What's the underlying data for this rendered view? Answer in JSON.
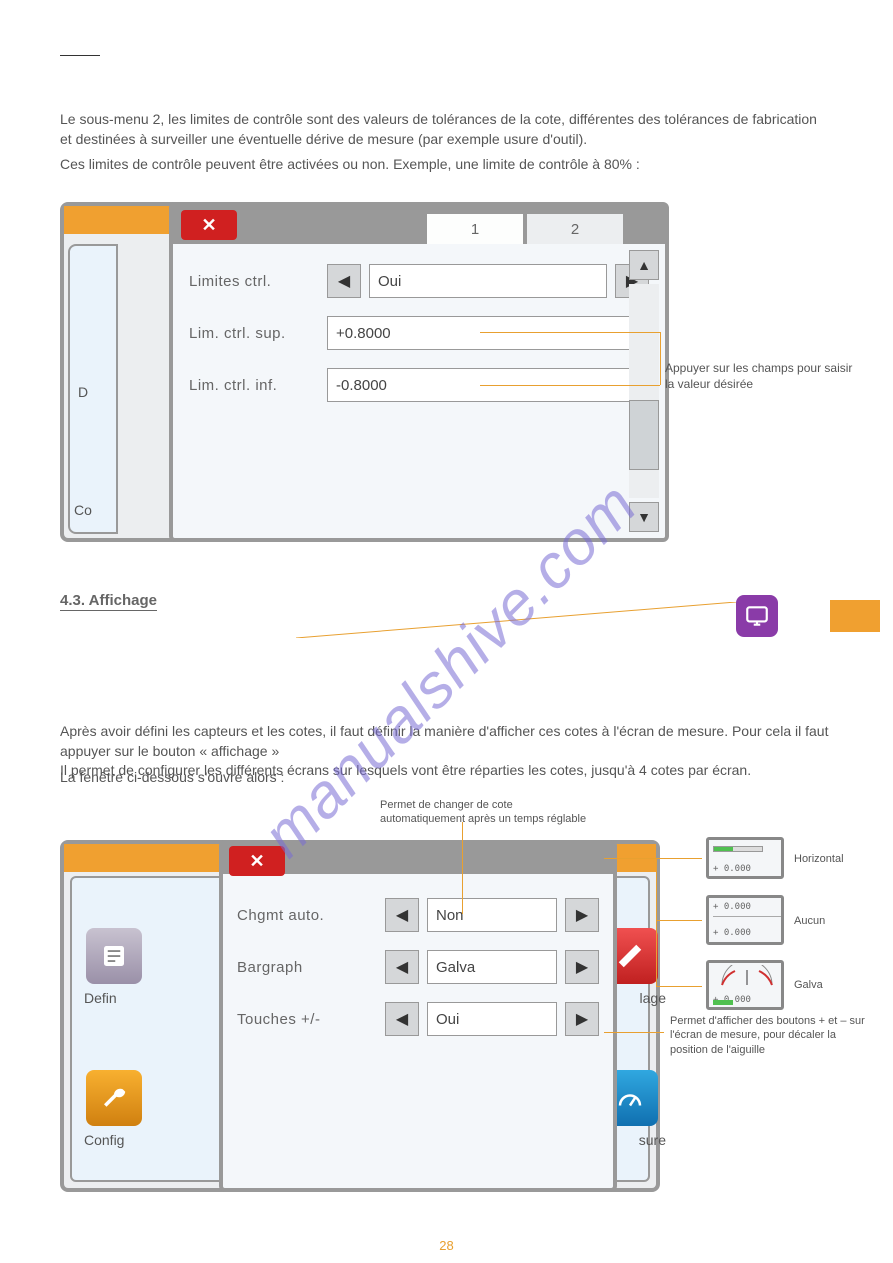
{
  "heading_underline": "",
  "para1": "Le sous-menu 2, les limites de contrôle sont des valeurs de tolérances de la cote, différentes des tolérances de fabrication et destinées à surveiller une éventuelle dérive de mesure (par exemple usure d'outil).",
  "para2": "Ces limites de contrôle peuvent être activées ou non. Exemple, une limite de contrôle à 80% :",
  "modal1": {
    "tabs": {
      "t1": "1",
      "t2": "2"
    },
    "rows": {
      "r1": {
        "label": "Limites ctrl.",
        "value": "Oui"
      },
      "r2": {
        "label": "Lim. ctrl. sup.",
        "value": "+0.8000"
      },
      "r3": {
        "label": "Lim. ctrl. inf.",
        "value": "-0.8000"
      }
    },
    "cutD": "D",
    "cutC": "Co"
  },
  "note_modal1": "Appuyer sur les champs pour saisir la valeur désirée",
  "mid_heading": "4.3. Affichage",
  "mid_para1a": "Après avoir défini les capteurs et les cotes, il faut définir la manière d'afficher ces cotes à l'écran de mesure. Pour cela il faut appuyer sur le bouton « affichage »",
  "mid_para1b": "Il permet de configurer les différents écrans sur lesquels vont être réparties les cotes, jusqu'à 4 cotes par écran.",
  "mid_para2": "La fenêtre ci-dessous s'ouvre alors :",
  "modal2": {
    "rows": {
      "r1": {
        "label": "Chgmt auto.",
        "value": "Non"
      },
      "r2": {
        "label": "Bargraph",
        "value": "Galva"
      },
      "r3": {
        "label": "Touches +/-",
        "value": "Oui"
      }
    },
    "bg": {
      "defin": "Defin",
      "lage": "lage",
      "config": "Config",
      "sure": "sure"
    }
  },
  "thumbs": {
    "val": "+ 0.000"
  },
  "annot2": {
    "top": "Permet de changer de cote automatiquement après un temps réglable",
    "bar": "Horizontal",
    "none": "Aucun",
    "galva": "Galva",
    "btm": "Permet d'afficher des boutons + et – sur l'écran de mesure, pour décaler la position de l'aiguille"
  },
  "footer_pg": "28",
  "watermark": "manualshive.com"
}
